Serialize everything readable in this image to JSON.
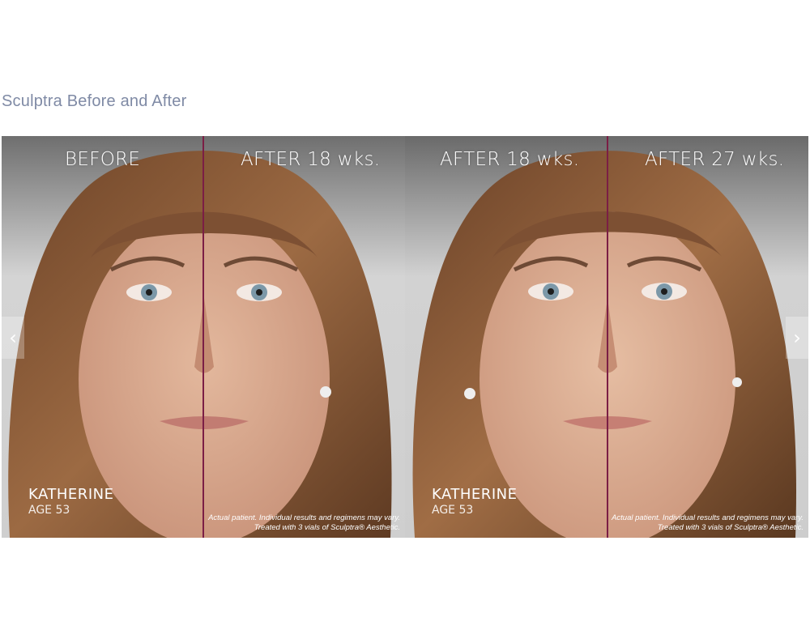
{
  "page": {
    "title": "Sculptra Before and After"
  },
  "slides": [
    {
      "left_label": "BEFORE",
      "right_label": "AFTER 18 wks.",
      "patient_name": "KATHERINE",
      "patient_age": "AGE 53",
      "disclaimer_line1": "Actual patient. Individual results and regimens may vary.",
      "disclaimer_line2": "Treated with 3 vials of Sculptra® Aesthetic."
    },
    {
      "left_label": "AFTER 18 wks.",
      "right_label": "AFTER 27 wks.",
      "patient_name": "KATHERINE",
      "patient_age": "AGE 53",
      "disclaimer_line1": "Actual patient. Individual results and regimens may vary.",
      "disclaimer_line2": "Treated with 3 vials of Sculptra® Aesthetic."
    }
  ],
  "nav": {
    "prev_icon": "‹",
    "next_icon": "›"
  },
  "colors": {
    "title": "#7f8aa5",
    "divider": "#7b1e45",
    "hair": "#8a5a36",
    "skin": "#d7a88c"
  }
}
